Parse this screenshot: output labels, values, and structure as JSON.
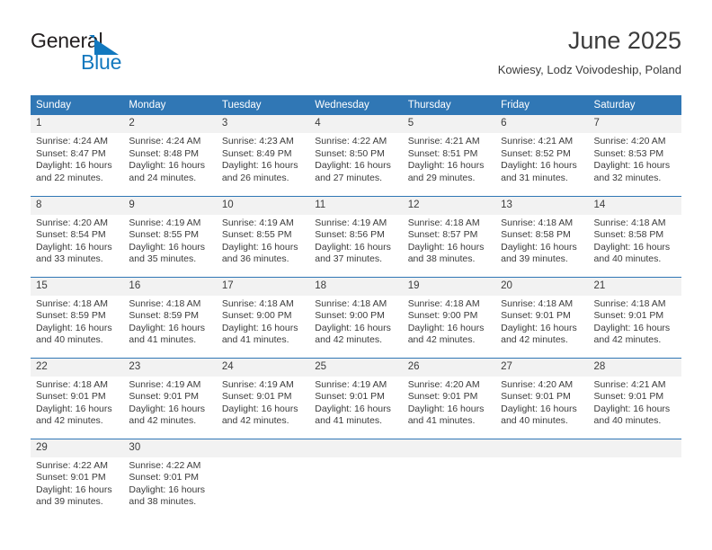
{
  "brand": {
    "name_part1": "General",
    "name_part2": "Blue",
    "triangle_icon": "triangle-logo-icon",
    "color_dark": "#231f20",
    "color_blue": "#1278be"
  },
  "header": {
    "title": "June 2025",
    "subtitle": "Kowiesy, Lodz Voivodeship, Poland"
  },
  "theme": {
    "header_blue": "#3077b5",
    "daynum_band": "#f2f2f2",
    "text": "#3b3b3b"
  },
  "calendar": {
    "weekday_headers": [
      "Sunday",
      "Monday",
      "Tuesday",
      "Wednesday",
      "Thursday",
      "Friday",
      "Saturday"
    ],
    "weeks": [
      [
        {
          "day": "1",
          "sunrise": "Sunrise: 4:24 AM",
          "sunset": "Sunset: 8:47 PM",
          "daylight_line1": "Daylight: 16 hours",
          "daylight_line2": "and 22 minutes."
        },
        {
          "day": "2",
          "sunrise": "Sunrise: 4:24 AM",
          "sunset": "Sunset: 8:48 PM",
          "daylight_line1": "Daylight: 16 hours",
          "daylight_line2": "and 24 minutes."
        },
        {
          "day": "3",
          "sunrise": "Sunrise: 4:23 AM",
          "sunset": "Sunset: 8:49 PM",
          "daylight_line1": "Daylight: 16 hours",
          "daylight_line2": "and 26 minutes."
        },
        {
          "day": "4",
          "sunrise": "Sunrise: 4:22 AM",
          "sunset": "Sunset: 8:50 PM",
          "daylight_line1": "Daylight: 16 hours",
          "daylight_line2": "and 27 minutes."
        },
        {
          "day": "5",
          "sunrise": "Sunrise: 4:21 AM",
          "sunset": "Sunset: 8:51 PM",
          "daylight_line1": "Daylight: 16 hours",
          "daylight_line2": "and 29 minutes."
        },
        {
          "day": "6",
          "sunrise": "Sunrise: 4:21 AM",
          "sunset": "Sunset: 8:52 PM",
          "daylight_line1": "Daylight: 16 hours",
          "daylight_line2": "and 31 minutes."
        },
        {
          "day": "7",
          "sunrise": "Sunrise: 4:20 AM",
          "sunset": "Sunset: 8:53 PM",
          "daylight_line1": "Daylight: 16 hours",
          "daylight_line2": "and 32 minutes."
        }
      ],
      [
        {
          "day": "8",
          "sunrise": "Sunrise: 4:20 AM",
          "sunset": "Sunset: 8:54 PM",
          "daylight_line1": "Daylight: 16 hours",
          "daylight_line2": "and 33 minutes."
        },
        {
          "day": "9",
          "sunrise": "Sunrise: 4:19 AM",
          "sunset": "Sunset: 8:55 PM",
          "daylight_line1": "Daylight: 16 hours",
          "daylight_line2": "and 35 minutes."
        },
        {
          "day": "10",
          "sunrise": "Sunrise: 4:19 AM",
          "sunset": "Sunset: 8:55 PM",
          "daylight_line1": "Daylight: 16 hours",
          "daylight_line2": "and 36 minutes."
        },
        {
          "day": "11",
          "sunrise": "Sunrise: 4:19 AM",
          "sunset": "Sunset: 8:56 PM",
          "daylight_line1": "Daylight: 16 hours",
          "daylight_line2": "and 37 minutes."
        },
        {
          "day": "12",
          "sunrise": "Sunrise: 4:18 AM",
          "sunset": "Sunset: 8:57 PM",
          "daylight_line1": "Daylight: 16 hours",
          "daylight_line2": "and 38 minutes."
        },
        {
          "day": "13",
          "sunrise": "Sunrise: 4:18 AM",
          "sunset": "Sunset: 8:58 PM",
          "daylight_line1": "Daylight: 16 hours",
          "daylight_line2": "and 39 minutes."
        },
        {
          "day": "14",
          "sunrise": "Sunrise: 4:18 AM",
          "sunset": "Sunset: 8:58 PM",
          "daylight_line1": "Daylight: 16 hours",
          "daylight_line2": "and 40 minutes."
        }
      ],
      [
        {
          "day": "15",
          "sunrise": "Sunrise: 4:18 AM",
          "sunset": "Sunset: 8:59 PM",
          "daylight_line1": "Daylight: 16 hours",
          "daylight_line2": "and 40 minutes."
        },
        {
          "day": "16",
          "sunrise": "Sunrise: 4:18 AM",
          "sunset": "Sunset: 8:59 PM",
          "daylight_line1": "Daylight: 16 hours",
          "daylight_line2": "and 41 minutes."
        },
        {
          "day": "17",
          "sunrise": "Sunrise: 4:18 AM",
          "sunset": "Sunset: 9:00 PM",
          "daylight_line1": "Daylight: 16 hours",
          "daylight_line2": "and 41 minutes."
        },
        {
          "day": "18",
          "sunrise": "Sunrise: 4:18 AM",
          "sunset": "Sunset: 9:00 PM",
          "daylight_line1": "Daylight: 16 hours",
          "daylight_line2": "and 42 minutes."
        },
        {
          "day": "19",
          "sunrise": "Sunrise: 4:18 AM",
          "sunset": "Sunset: 9:00 PM",
          "daylight_line1": "Daylight: 16 hours",
          "daylight_line2": "and 42 minutes."
        },
        {
          "day": "20",
          "sunrise": "Sunrise: 4:18 AM",
          "sunset": "Sunset: 9:01 PM",
          "daylight_line1": "Daylight: 16 hours",
          "daylight_line2": "and 42 minutes."
        },
        {
          "day": "21",
          "sunrise": "Sunrise: 4:18 AM",
          "sunset": "Sunset: 9:01 PM",
          "daylight_line1": "Daylight: 16 hours",
          "daylight_line2": "and 42 minutes."
        }
      ],
      [
        {
          "day": "22",
          "sunrise": "Sunrise: 4:18 AM",
          "sunset": "Sunset: 9:01 PM",
          "daylight_line1": "Daylight: 16 hours",
          "daylight_line2": "and 42 minutes."
        },
        {
          "day": "23",
          "sunrise": "Sunrise: 4:19 AM",
          "sunset": "Sunset: 9:01 PM",
          "daylight_line1": "Daylight: 16 hours",
          "daylight_line2": "and 42 minutes."
        },
        {
          "day": "24",
          "sunrise": "Sunrise: 4:19 AM",
          "sunset": "Sunset: 9:01 PM",
          "daylight_line1": "Daylight: 16 hours",
          "daylight_line2": "and 42 minutes."
        },
        {
          "day": "25",
          "sunrise": "Sunrise: 4:19 AM",
          "sunset": "Sunset: 9:01 PM",
          "daylight_line1": "Daylight: 16 hours",
          "daylight_line2": "and 41 minutes."
        },
        {
          "day": "26",
          "sunrise": "Sunrise: 4:20 AM",
          "sunset": "Sunset: 9:01 PM",
          "daylight_line1": "Daylight: 16 hours",
          "daylight_line2": "and 41 minutes."
        },
        {
          "day": "27",
          "sunrise": "Sunrise: 4:20 AM",
          "sunset": "Sunset: 9:01 PM",
          "daylight_line1": "Daylight: 16 hours",
          "daylight_line2": "and 40 minutes."
        },
        {
          "day": "28",
          "sunrise": "Sunrise: 4:21 AM",
          "sunset": "Sunset: 9:01 PM",
          "daylight_line1": "Daylight: 16 hours",
          "daylight_line2": "and 40 minutes."
        }
      ],
      [
        {
          "day": "29",
          "sunrise": "Sunrise: 4:22 AM",
          "sunset": "Sunset: 9:01 PM",
          "daylight_line1": "Daylight: 16 hours",
          "daylight_line2": "and 39 minutes."
        },
        {
          "day": "30",
          "sunrise": "Sunrise: 4:22 AM",
          "sunset": "Sunset: 9:01 PM",
          "daylight_line1": "Daylight: 16 hours",
          "daylight_line2": "and 38 minutes."
        },
        {
          "day": "",
          "sunrise": "",
          "sunset": "",
          "daylight_line1": "",
          "daylight_line2": ""
        },
        {
          "day": "",
          "sunrise": "",
          "sunset": "",
          "daylight_line1": "",
          "daylight_line2": ""
        },
        {
          "day": "",
          "sunrise": "",
          "sunset": "",
          "daylight_line1": "",
          "daylight_line2": ""
        },
        {
          "day": "",
          "sunrise": "",
          "sunset": "",
          "daylight_line1": "",
          "daylight_line2": ""
        },
        {
          "day": "",
          "sunrise": "",
          "sunset": "",
          "daylight_line1": "",
          "daylight_line2": ""
        }
      ]
    ]
  }
}
